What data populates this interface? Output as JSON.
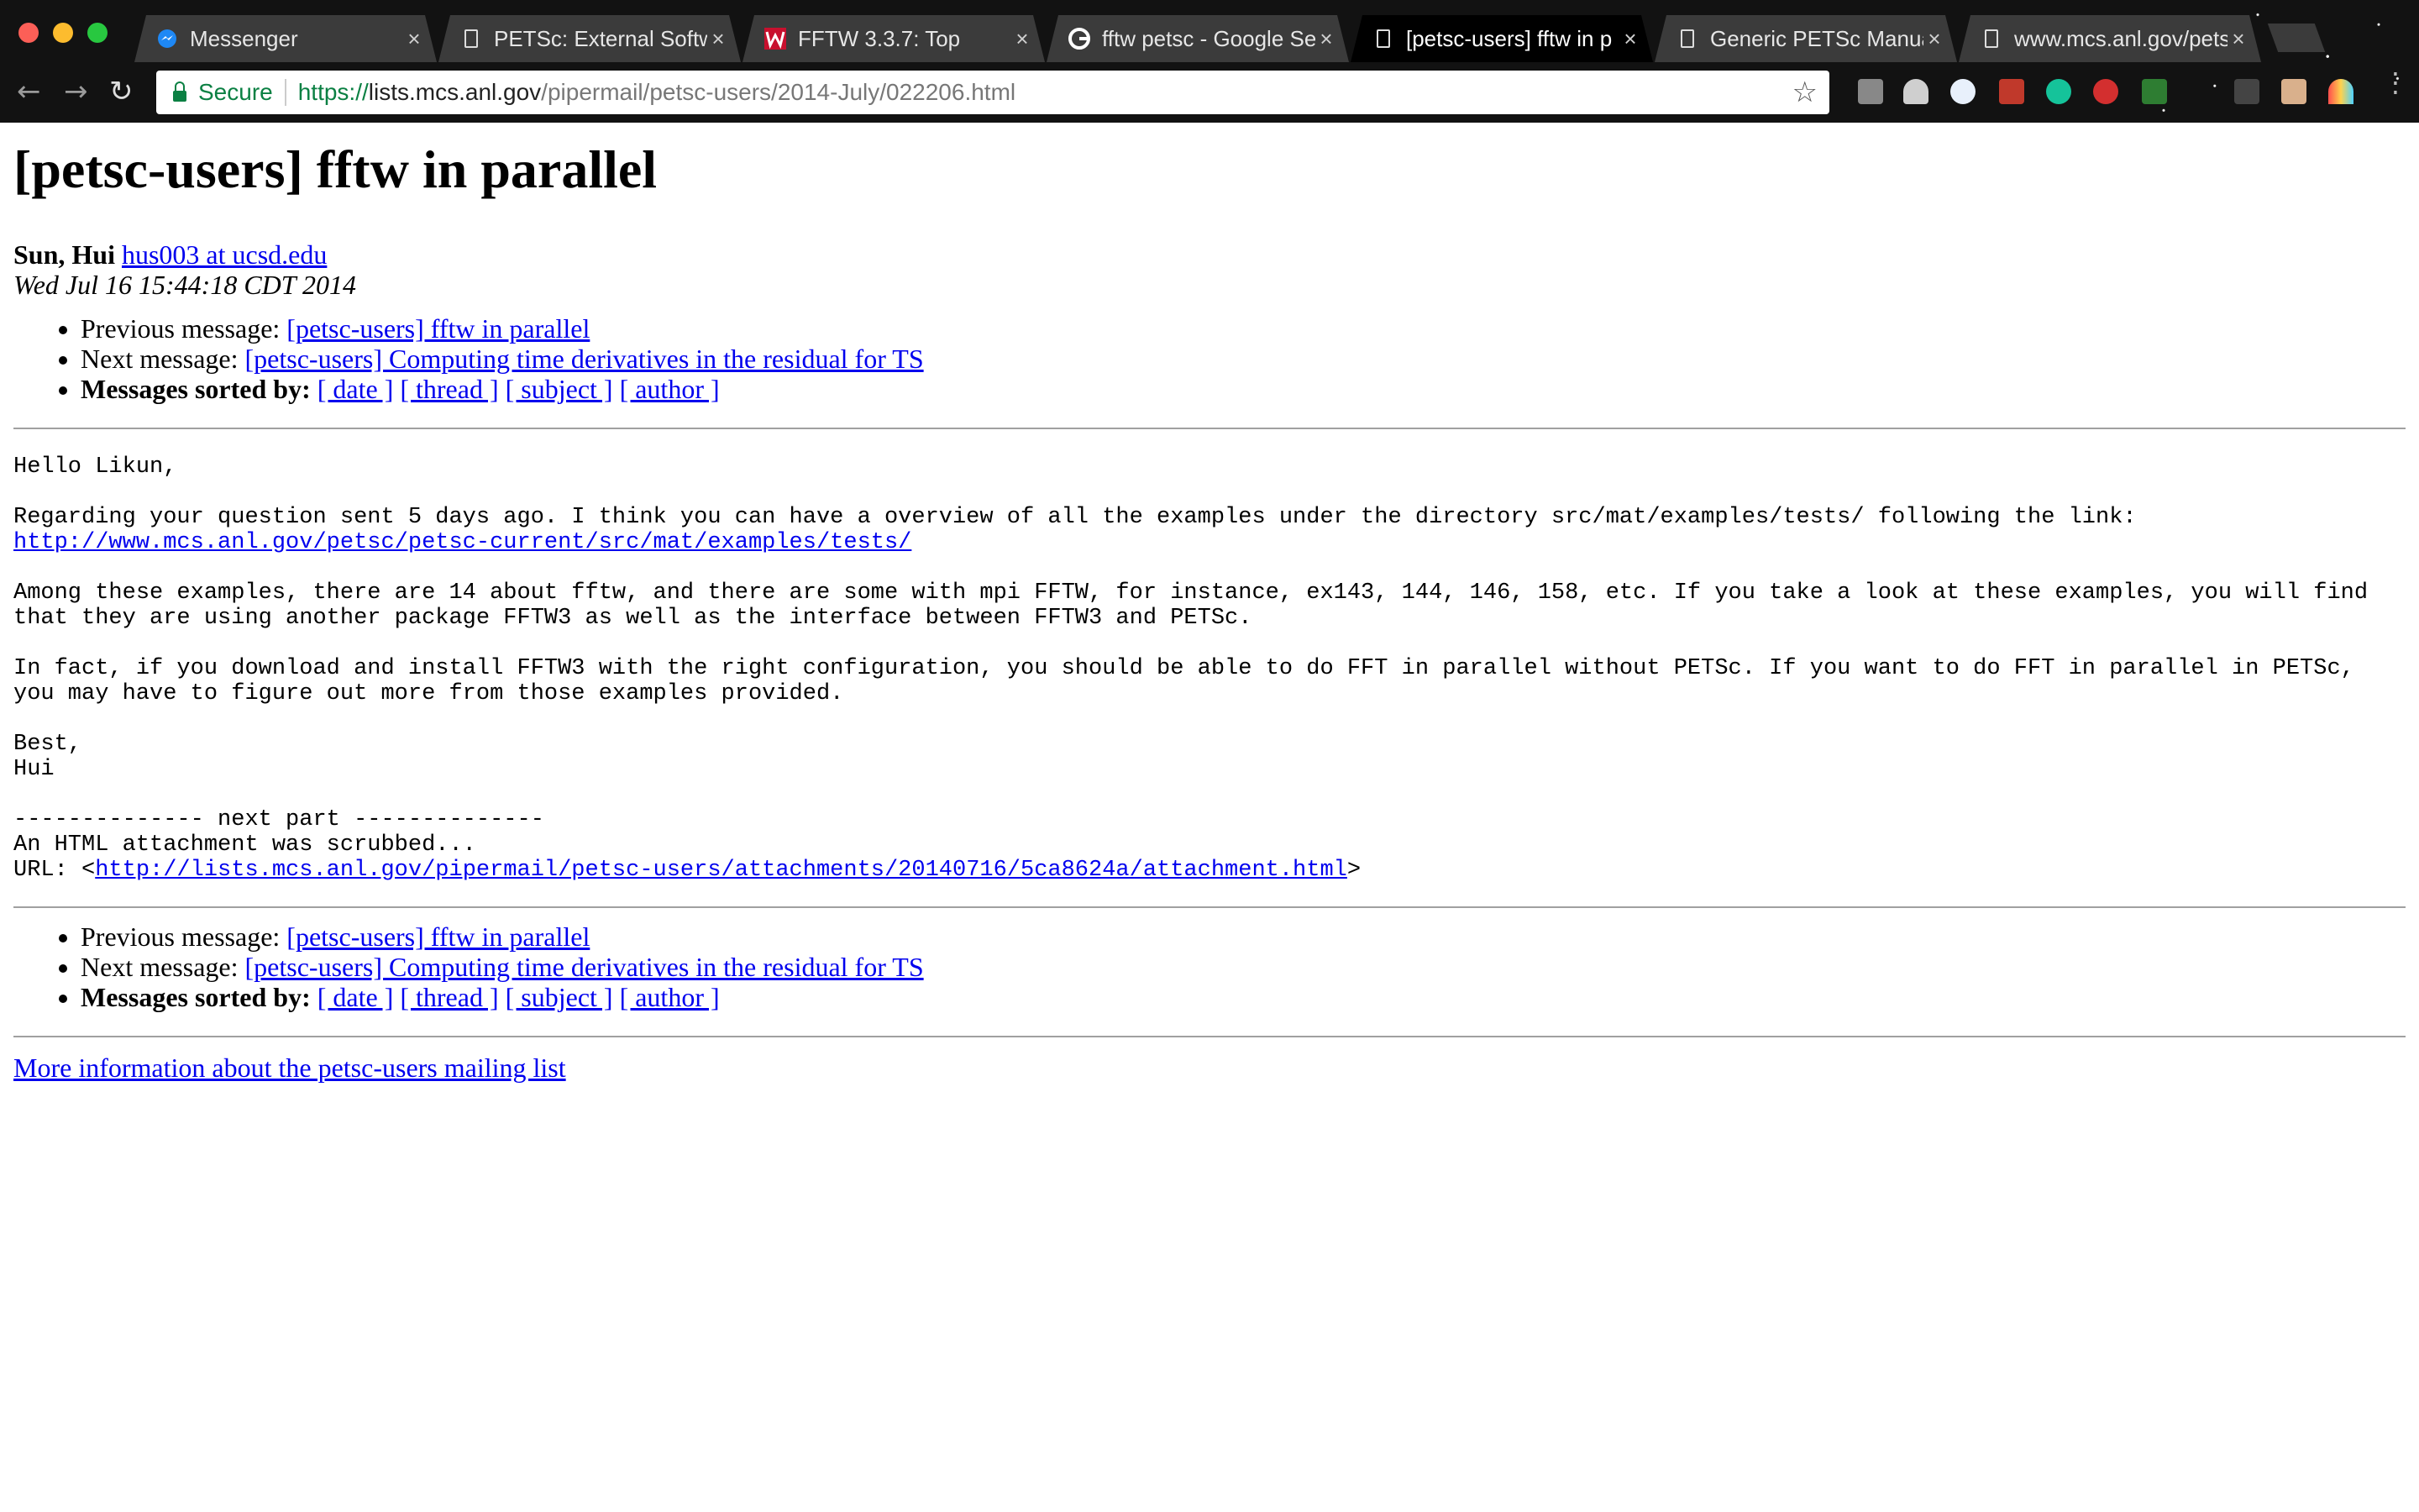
{
  "browser": {
    "tabs": [
      {
        "title": "Messenger",
        "icon": "messenger-icon",
        "active": false
      },
      {
        "title": "PETSc: External Softw",
        "icon": "document-icon",
        "active": false
      },
      {
        "title": "FFTW 3.3.7: Top",
        "icon": "w-logo-icon",
        "active": false
      },
      {
        "title": "fftw petsc - Google Se",
        "icon": "google-icon",
        "active": false
      },
      {
        "title": "[petsc-users] fftw in p",
        "icon": "document-icon",
        "active": true
      },
      {
        "title": "Generic PETSc Manua",
        "icon": "document-icon",
        "active": false
      },
      {
        "title": "www.mcs.anl.gov/pets",
        "icon": "document-icon",
        "active": false
      }
    ],
    "secure_label": "Secure",
    "url_scheme": "https://",
    "url_host": "lists.mcs.anl.gov",
    "url_path": "/pipermail/petsc-users/2014-July/022206.html",
    "accent_secure": "#0b8043"
  },
  "message": {
    "title": "[petsc-users] fftw in parallel",
    "author_name": "Sun, Hui",
    "author_email": "hus003 at ucsd.edu ",
    "date": "Wed Jul 16 15:44:18 CDT 2014",
    "nav": {
      "prev_label": "Previous message:",
      "prev_link": "[petsc-users] fftw in parallel",
      "next_label": "Next message:",
      "next_link": "[petsc-users] Computing time derivatives in the residual for TS",
      "sorted_label": "Messages sorted by:",
      "sort_date": "[ date ]",
      "sort_thread": "[ thread ]",
      "sort_subject": "[ subject ]",
      "sort_author": "[ author ]"
    },
    "body": {
      "greeting": "Hello Likun,",
      "para1": "Regarding your question sent 5 days ago. I think you can have a overview of all the examples under the directory src/mat/examples/tests/ following the link:",
      "link1": "http://www.mcs.anl.gov/petsc/petsc-current/src/mat/examples/tests/",
      "para2": "Among these examples, there are 14 about fftw, and there are some with mpi FFTW, for instance, ex143, 144, 146, 158, etc. If you take a look at these examples, you will find that they are using another package FFTW3 as well as the interface between FFTW3 and PETSc.",
      "para3": "In fact, if you download and install FFTW3 with the right configuration, you should be able to do FFT in parallel without PETSc. If you want to do FFT in parallel in PETSc, you may have to figure out more from those examples provided.",
      "signoff": "Best,",
      "signature": "Hui",
      "next_part": "-------------- next part --------------",
      "scrubbed": "An HTML attachment was scrubbed...",
      "url_label": "URL: <",
      "attachment_url": "http://lists.mcs.anl.gov/pipermail/petsc-users/attachments/20140716/5ca8624a/attachment.html",
      "url_close": ">"
    },
    "footer_link": "More information about the petsc-users mailing list"
  }
}
